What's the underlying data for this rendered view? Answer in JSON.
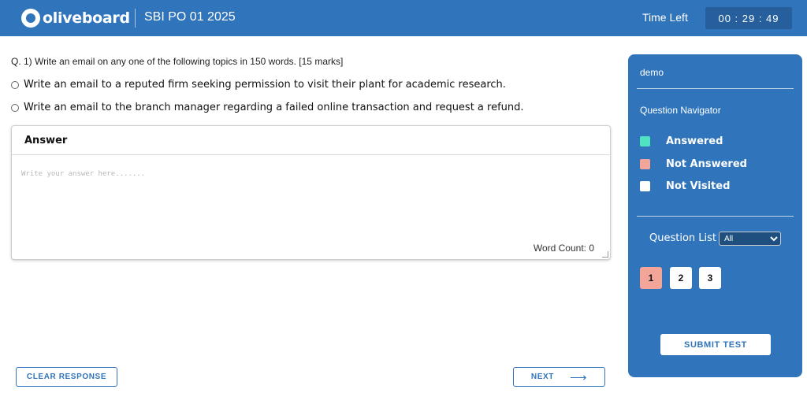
{
  "header": {
    "brand": "oliveboard",
    "exam_title": "SBI PO 01 2025",
    "time_left_label": "Time Left",
    "timer": "00 : 29 : 49",
    "color": "#3075bb"
  },
  "question": {
    "text": "Q. 1) Write an email on any one of the following topics in 150 words. [15 marks]",
    "options": [
      {
        "label": "Write an email to a reputed firm seeking permission to visit their plant for academic research."
      },
      {
        "label": "Write an email to the branch manager regarding a failed online transaction and request a refund."
      }
    ]
  },
  "answer": {
    "heading": "Answer",
    "placeholder": "Write your answer here.......",
    "value": "",
    "word_count": "Word Count: 0"
  },
  "buttons": {
    "clear": "CLEAR RESPONSE",
    "next": "NEXT"
  },
  "panel": {
    "user": "demo",
    "navigator_title": "Question Navigator",
    "legend": [
      {
        "label": "Answered",
        "color": "#4fe3c1"
      },
      {
        "label": "Not Answered",
        "color": "#f4a59a"
      },
      {
        "label": "Not Visited",
        "color": "#ffffff"
      }
    ],
    "question_list_label": "Question List",
    "question_list_selected": "All",
    "questions": [
      "1",
      "2",
      "3"
    ],
    "current_question": "1",
    "submit": "SUBMIT TEST"
  }
}
